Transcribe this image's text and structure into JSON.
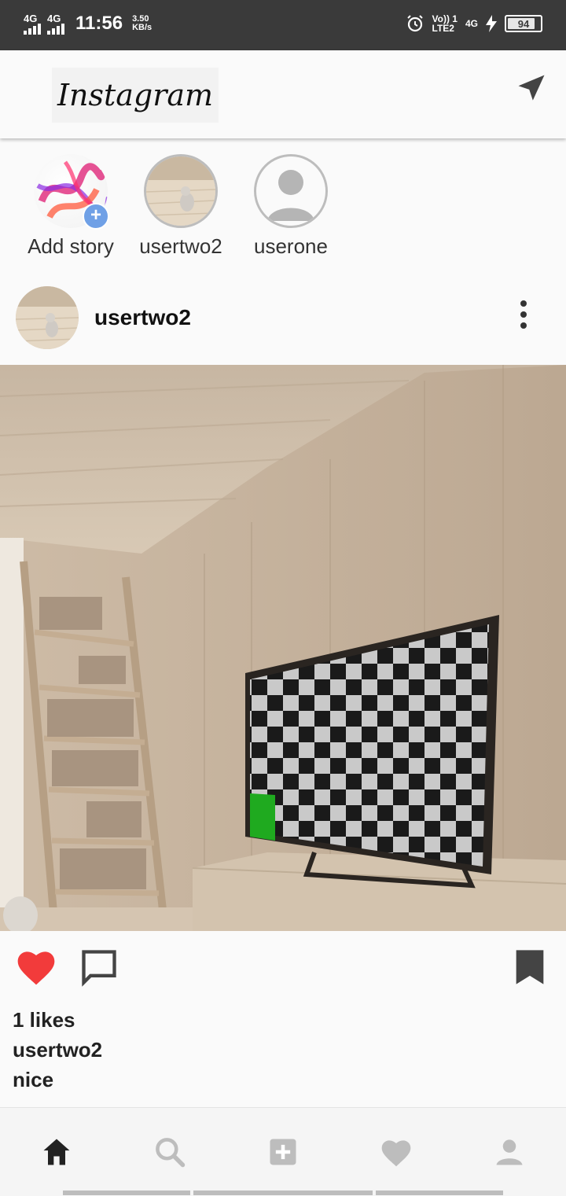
{
  "status_bar": {
    "sim1": "4G",
    "sim2": "4G",
    "time": "11:56",
    "speed_value": "3.50",
    "speed_unit": "KB/s",
    "volte_top": "Vo)) 1",
    "volte_bottom": "LTE2",
    "net_type": "4G",
    "battery": "94",
    "battery_level": 0.94
  },
  "app_bar": {
    "logo": "Instagram",
    "icons": [
      "send-icon"
    ]
  },
  "stories": [
    {
      "name": "Add story",
      "kind": "add"
    },
    {
      "name": "usertwo2",
      "kind": "photo"
    },
    {
      "name": "userone",
      "kind": "placeholder"
    }
  ],
  "post": {
    "username": "usertwo2",
    "likes": "1 likes",
    "caption_user": "usertwo2",
    "caption": "nice",
    "liked": true
  },
  "bottom_nav": {
    "items": [
      "home-icon",
      "search-icon",
      "add-post-icon",
      "activity-heart-icon",
      "profile-icon"
    ],
    "active": "home-icon"
  },
  "colors": {
    "status_bar": "#3a3a3a",
    "like_red": "#f23b3b",
    "nav_active": "#222222",
    "nav_inactive": "#bdbdbd",
    "add_badge": "#6fa0e6"
  }
}
